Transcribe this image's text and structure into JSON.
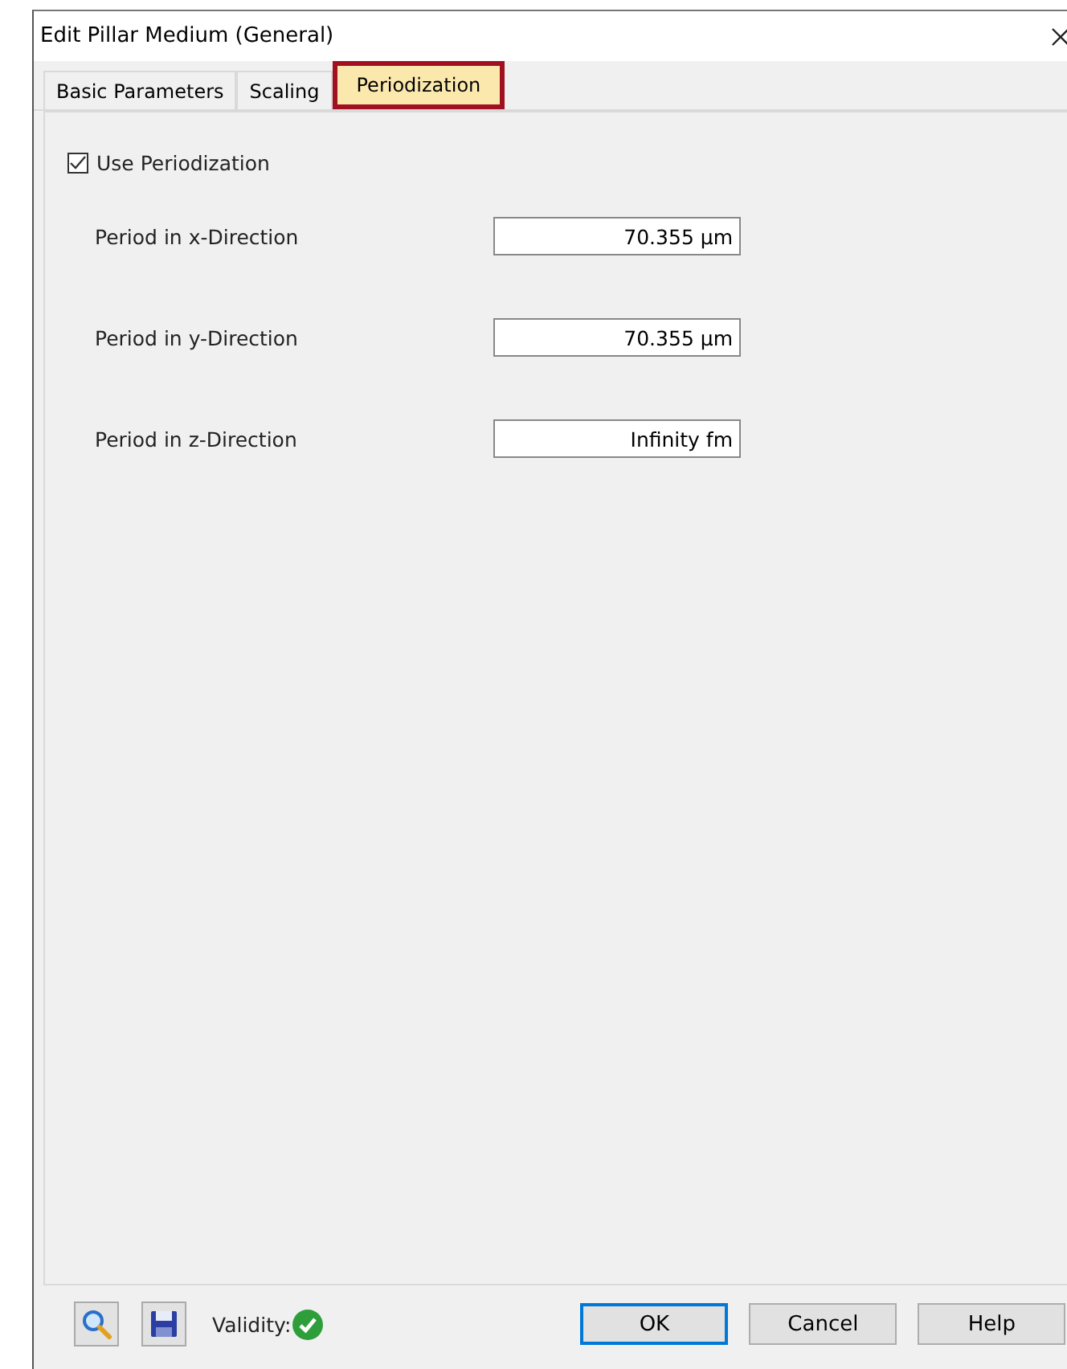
{
  "window": {
    "title": "Edit Pillar Medium (General)"
  },
  "tabs": [
    {
      "label": "Basic Parameters",
      "selected": false
    },
    {
      "label": "Scaling",
      "selected": false
    },
    {
      "label": "Periodization",
      "selected": true
    }
  ],
  "use_periodization": {
    "label": "Use Periodization",
    "checked": true
  },
  "fields": [
    {
      "label": "Period in x-Direction",
      "value": "70.355 µm"
    },
    {
      "label": "Period in y-Direction",
      "value": "70.355 µm"
    },
    {
      "label": "Period in z-Direction",
      "value": "Infinity fm"
    }
  ],
  "footer": {
    "validity_label": "Validity:",
    "valid": true,
    "buttons": [
      {
        "label": "OK",
        "default": true
      },
      {
        "label": "Cancel",
        "default": false
      },
      {
        "label": "Help",
        "default": false
      }
    ]
  }
}
